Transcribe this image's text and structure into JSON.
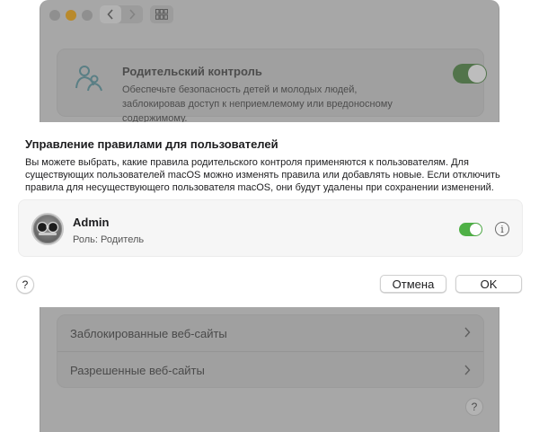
{
  "background_window": {
    "parental_control": {
      "title": "Родительский контроль",
      "description": "Обеспечьте безопасность детей и молодых людей, заблокировав доступ к неприемлемому или вредоносному содержимому.",
      "enabled": true
    },
    "site_rows": [
      {
        "label": "Заблокированные веб-сайты"
      },
      {
        "label": "Разрешенные веб-сайты"
      }
    ],
    "help_label": "?"
  },
  "sheet": {
    "title": "Управление правилами для пользователей",
    "description": "Вы можете выбрать, какие правила родительского контроля применяются к пользователям. Для существующих пользователей macOS можно изменять правила или добавлять новые. Если отключить правила для несуществующего пользователя macOS, они будут удалены при сохранении изменений.",
    "user": {
      "name": "Admin",
      "role": "Роль: Родитель",
      "enabled": true,
      "info_label": "i"
    },
    "help_label": "?",
    "cancel_label": "Отмена",
    "ok_label": "OK"
  },
  "colors": {
    "toggle_on": "#4fb046",
    "dim_overlay": "#a7a7a7"
  },
  "icons": {
    "back": "chevron-left-icon",
    "forward": "chevron-right-icon",
    "grid": "grid-icon",
    "parental": "parental-control-icon",
    "chevron": "chevron-right-icon",
    "info": "info-icon",
    "help": "help-icon"
  }
}
